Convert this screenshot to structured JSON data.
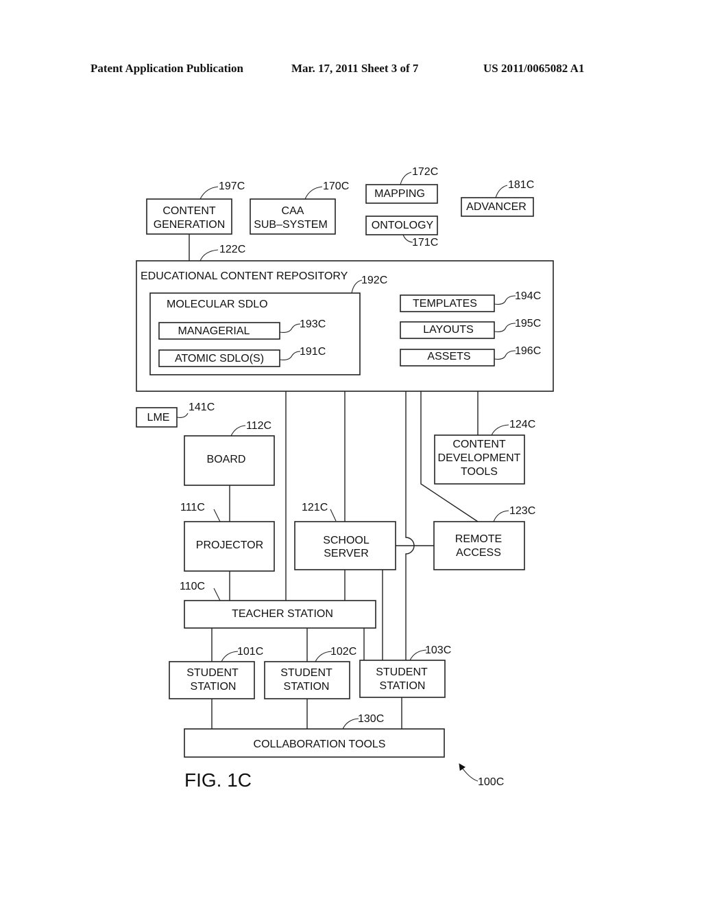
{
  "header": {
    "left": "Patent Application Publication",
    "middle": "Mar. 17, 2011  Sheet 3 of 7",
    "right": "US 2011/0065082 A1"
  },
  "figure": {
    "label": "FIG. 1C",
    "overall_ref": "100C"
  },
  "boxes": {
    "content_generation": {
      "line1": "CONTENT",
      "line2": "GENERATION",
      "ref": "197C"
    },
    "caa": {
      "line1": "CAA",
      "line2": "SUB–SYSTEM",
      "ref": "170C"
    },
    "mapping": {
      "label": "MAPPING",
      "ref": "172C"
    },
    "ontology": {
      "label": "ONTOLOGY",
      "ref": "171C"
    },
    "advancer": {
      "label": "ADVANCER",
      "ref": "181C"
    },
    "repository": {
      "label": "EDUCATIONAL  CONTENT  REPOSITORY",
      "ref": "122C"
    },
    "molecular": {
      "label": "MOLECULAR  SDLO",
      "ref": "192C"
    },
    "managerial": {
      "label": "MANAGERIAL",
      "ref": "193C"
    },
    "atomic": {
      "label": "ATOMIC  SDLO(S)",
      "ref": "191C"
    },
    "templates": {
      "label": "TEMPLATES",
      "ref": "194C"
    },
    "layouts": {
      "label": "LAYOUTS",
      "ref": "195C"
    },
    "assets": {
      "label": "ASSETS",
      "ref": "196C"
    },
    "lme": {
      "label": "LME",
      "ref": "141C"
    },
    "board": {
      "label": "BOARD",
      "ref": "112C"
    },
    "content_dev": {
      "line1": "CONTENT",
      "line2": "DEVELOPMENT",
      "line3": "TOOLS",
      "ref": "124C"
    },
    "projector": {
      "label": "PROJECTOR",
      "ref": "111C"
    },
    "school_server": {
      "line1": "SCHOOL",
      "line2": "SERVER",
      "ref": "121C"
    },
    "remote_access": {
      "line1": "REMOTE",
      "line2": "ACCESS",
      "ref": "123C"
    },
    "teacher_station": {
      "label": "TEACHER  STATION",
      "ref": "110C"
    },
    "student1": {
      "line1": "STUDENT",
      "line2": "STATION",
      "ref": "101C"
    },
    "student2": {
      "line1": "STUDENT",
      "line2": "STATION",
      "ref": "102C"
    },
    "student3": {
      "line1": "STUDENT",
      "line2": "STATION",
      "ref": "103C"
    },
    "collaboration": {
      "label": "COLLABORATION  TOOLS",
      "ref": "130C"
    }
  }
}
